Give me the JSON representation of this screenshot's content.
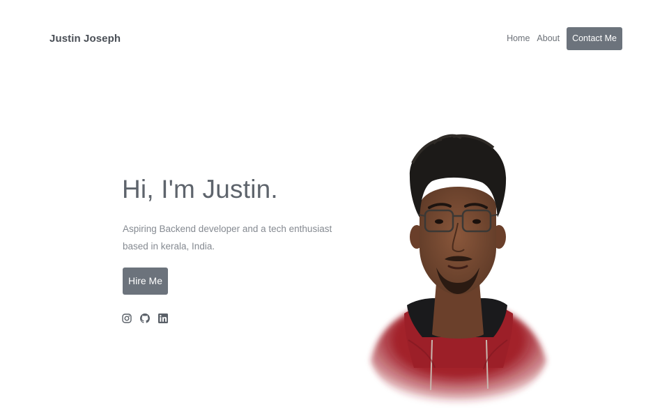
{
  "navbar": {
    "brand": "Justin Joseph",
    "links": [
      {
        "label": "Home"
      },
      {
        "label": "About"
      }
    ],
    "cta_label": "Contact Me"
  },
  "hero": {
    "title": "Hi, I'm Justin.",
    "subtitle": "Aspiring Backend developer and a tech enthusiast based in kerala, India.",
    "button_label": "Hire Me",
    "socials": [
      {
        "icon": "instagram-icon"
      },
      {
        "icon": "github-icon"
      },
      {
        "icon": "linkedin-icon"
      }
    ]
  },
  "portrait": {
    "subject": "portrait-photo",
    "colors": {
      "hoodie": "#a3222c",
      "skin": "#7a4a32",
      "hair": "#1c1a18"
    }
  },
  "colors": {
    "accent_button": "#6c737c",
    "text_dark": "#4a4f56",
    "text_muted": "#858a91"
  }
}
